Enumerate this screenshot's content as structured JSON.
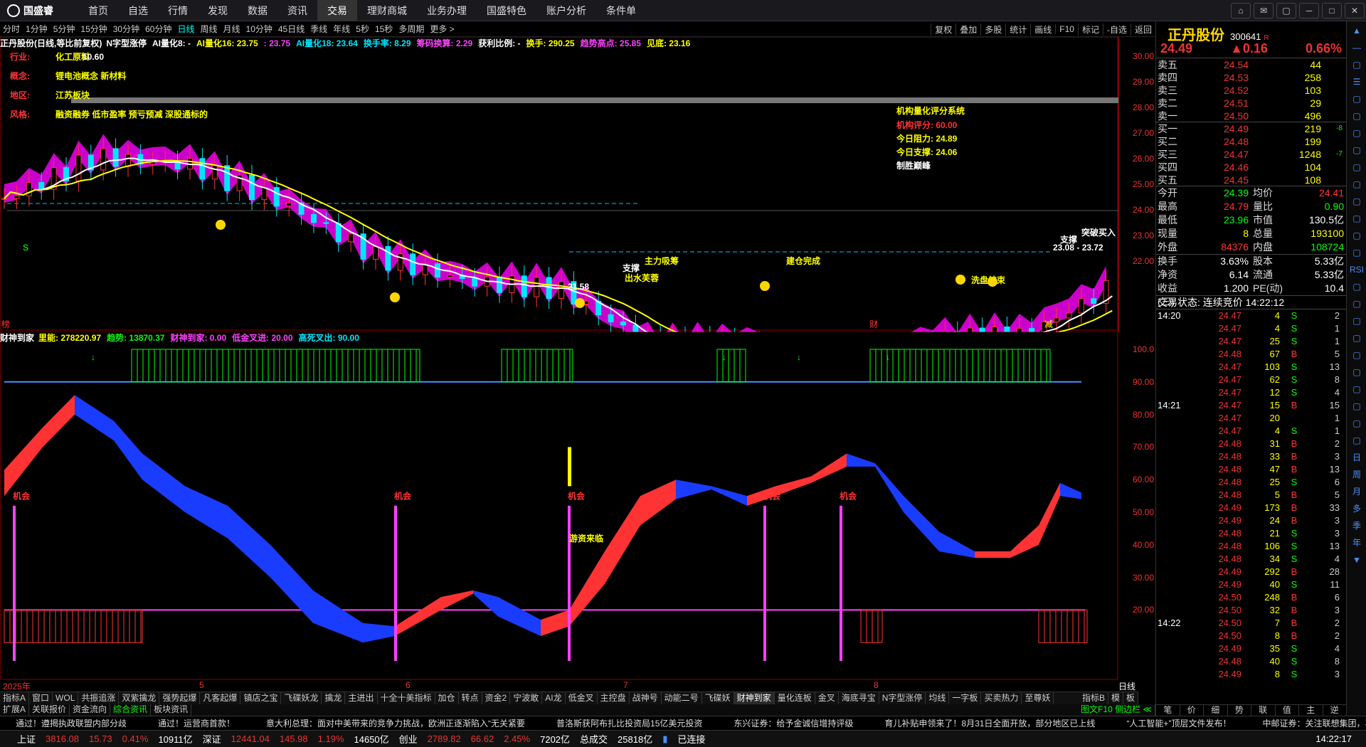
{
  "app": {
    "logo_text": "国盛睿"
  },
  "menu": [
    "首页",
    "自选",
    "行情",
    "发现",
    "数据",
    "资讯",
    "交易",
    "理财商城",
    "业务办理",
    "国盛特色",
    "账户分析",
    "条件单"
  ],
  "window_controls": [
    "⌂",
    "✉",
    "▢",
    "─",
    "□",
    "✕"
  ],
  "periods": [
    "分时",
    "1分钟",
    "5分钟",
    "15分钟",
    "30分钟",
    "60分钟",
    "日线",
    "周线",
    "月线",
    "10分钟",
    "45日线",
    "季线",
    "年线",
    "5秒",
    "15秒",
    "多周期",
    "更多 >"
  ],
  "active_period": "日线",
  "tools": [
    "复权",
    "叠加",
    "多股",
    "统计",
    "画线",
    "F10",
    "标记",
    "-自选",
    "返回"
  ],
  "indicator1": {
    "title": "正丹股份(日线,等比前复权)",
    "items": [
      {
        "t": "N字型涨停",
        "c": "wh"
      },
      {
        "t": "AI量化8: -",
        "c": "wh"
      },
      {
        "t": "AI量化16: 23.75",
        "c": "yl"
      },
      {
        "t": ": 23.75",
        "c": "mg"
      },
      {
        "t": "AI量化18: 23.64",
        "c": "cy"
      },
      {
        "t": "换手率: 8.29",
        "c": "cy"
      },
      {
        "t": "筹码换算: 2.29",
        "c": "mg"
      },
      {
        "t": "获利比例: -",
        "c": "wh"
      },
      {
        "t": "换手: 290.25",
        "c": "yl"
      },
      {
        "t": "趋势高点: 25.85",
        "c": "mg"
      },
      {
        "t": "见底: 23.16",
        "c": "yl"
      }
    ]
  },
  "info_panel": [
    {
      "label": "行业:",
      "value": "化工原料"
    },
    {
      "label": "概念:",
      "value": "锂电池概念 新材料"
    },
    {
      "label": "地区:",
      "value": "江苏板块"
    },
    {
      "label": "风格:",
      "value": "融资融券 低市盈率 预亏预减 深股通标的"
    }
  ],
  "score_box": {
    "title": "机构量化评分系统",
    "rows": [
      {
        "t": "机构评分: 60.00",
        "c": "up"
      },
      {
        "t": "今日阻力: 24.89",
        "c": "yl"
      },
      {
        "t": "今日支撑: 24.06",
        "c": "yl"
      },
      {
        "t": "制胜巅峰",
        "c": "wh"
      }
    ]
  },
  "annotations": [
    {
      "t": "10.60",
      "c": "wh"
    },
    {
      "t": "←21.58",
      "c": "wh"
    },
    {
      "t": "支撑",
      "c": "wh"
    },
    {
      "t": "出水芙蓉",
      "c": "yl"
    },
    {
      "t": "主力吸筹",
      "c": "yl"
    },
    {
      "t": "建仓完成",
      "c": "yl"
    },
    {
      "t": "洗盘结束",
      "c": "yl"
    },
    {
      "t": "支撑",
      "c": "wh"
    },
    {
      "t": "突破买入",
      "c": "wh"
    },
    {
      "t": "23.08 - 23.72",
      "c": "wh"
    }
  ],
  "main_markers": [
    "榜",
    "S",
    "S",
    "财",
    "减"
  ],
  "main_y_axis": [
    "30.00",
    "29.00",
    "28.00",
    "27.00",
    "26.00",
    "25.00",
    "24.00",
    "23.00",
    "22.00"
  ],
  "indicator2": {
    "title": "财神到家",
    "items": [
      {
        "t": "里能: 278220.97",
        "c": "yl"
      },
      {
        "t": "趋势: 13870.37",
        "c": "dn"
      },
      {
        "t": "财神到家: 0.00",
        "c": "mg"
      },
      {
        "t": "低金叉进: 20.00",
        "c": "mg"
      },
      {
        "t": "高死叉出: 90.00",
        "c": "cy"
      }
    ]
  },
  "sub_labels": [
    "机会",
    "机会",
    "机会",
    "机会",
    "机会"
  ],
  "sub_special_label": "游资来临",
  "sub_y_axis": [
    "100.0",
    "90.00",
    "80.00",
    "70.00",
    "60.00",
    "50.00",
    "40.00",
    "30.00",
    "20.00"
  ],
  "dates": [
    "2025年",
    "5",
    "6",
    "7",
    "8"
  ],
  "date_axis_label": "日线",
  "tabs1": [
    "指标A",
    "窗口",
    "WOL",
    "共振追涨",
    "双紫擒龙",
    "强势起爆",
    "凡客起爆",
    "镇店之宝",
    "飞碟妖龙",
    "擒龙",
    "主进出",
    "十全十美指标",
    "加仓",
    "转点",
    "资金2",
    "宁波敢",
    "AI龙",
    "低金叉",
    "主控盘",
    "战神号",
    "动能二号",
    "飞碟妖",
    "财神到家",
    "量化连板",
    "金叉",
    "海底寻宝",
    "N字型涨停",
    "均线",
    "一字板",
    "买卖热力",
    "至尊妖"
  ],
  "tabs1_active": "财神到家",
  "tabs1_right": [
    "指标B",
    "模",
    "板"
  ],
  "tabs2": [
    "扩展A",
    "关联报价",
    "资金流向",
    "综合资讯",
    "板块资讯"
  ],
  "tabs2_active": "综合资讯",
  "tabs2_right": "图文F10 侧边栏 ≪",
  "news": [
    "通过！遵揭执政联盟内部分歧",
    "通过！运营商首款！",
    "意大利总理：面对中美带来的竞争力挑战，欧洲正逐渐陷入“无关紧要",
    "普洛斯获阿布扎比投资局15亿美元投资",
    "东兴证券：给予金诚信增持评级",
    "育儿补贴申领来了！8月31日全面开放，部分地区已上线",
    "“人工智能+”顶层文件发布！",
    "中邮证券：关注联想集团，再次..."
  ],
  "status": {
    "sh": {
      "label": "上证",
      "value": "3816.08",
      "chg": "15.73",
      "pct": "0.41%",
      "amt": "10911亿"
    },
    "sz": {
      "label": "深证",
      "value": "12441.04",
      "chg": "145.98",
      "pct": "1.19%",
      "amt": "14650亿"
    },
    "cy": {
      "label": "创业",
      "value": "2789.82",
      "chg": "66.62",
      "pct": "2.45%",
      "amt": "7202亿"
    },
    "total": {
      "label": "总成交",
      "value": "25818亿"
    },
    "connected": "已连接",
    "time": "14:22:17"
  },
  "quote": {
    "name": "正丹股份",
    "code": "300641",
    "badge": "R",
    "price": "24.49",
    "change": "▲0.16",
    "pct": "0.66%",
    "asks": [
      {
        "label": "卖五",
        "price": "24.54",
        "vol": "44",
        "chg": ""
      },
      {
        "label": "卖四",
        "price": "24.53",
        "vol": "258",
        "chg": ""
      },
      {
        "label": "卖三",
        "price": "24.52",
        "vol": "103",
        "chg": ""
      },
      {
        "label": "卖二",
        "price": "24.51",
        "vol": "29",
        "chg": ""
      },
      {
        "label": "卖一",
        "price": "24.50",
        "vol": "496",
        "chg": ""
      }
    ],
    "bids": [
      {
        "label": "买一",
        "price": "24.49",
        "vol": "219",
        "chg": "-8"
      },
      {
        "label": "买二",
        "price": "24.48",
        "vol": "199",
        "chg": ""
      },
      {
        "label": "买三",
        "price": "24.47",
        "vol": "1248",
        "chg": "-7"
      },
      {
        "label": "买四",
        "price": "24.46",
        "vol": "104",
        "chg": ""
      },
      {
        "label": "买五",
        "price": "24.45",
        "vol": "108",
        "chg": ""
      }
    ],
    "stats": [
      {
        "k1": "今开",
        "v1": "24.39",
        "c1": "dn",
        "k2": "均价",
        "v2": "24.41",
        "c2": "up"
      },
      {
        "k1": "最高",
        "v1": "24.79",
        "c1": "up",
        "k2": "量比",
        "v2": "0.90",
        "c2": "dn"
      },
      {
        "k1": "最低",
        "v1": "23.96",
        "c1": "dn",
        "k2": "市值",
        "v2": "130.5亿",
        "c2": "wh"
      },
      {
        "k1": "现量",
        "v1": "8",
        "c1": "yl",
        "k2": "总量",
        "v2": "193100",
        "c2": "yl"
      },
      {
        "k1": "外盘",
        "v1": "84376",
        "c1": "up",
        "k2": "内盘",
        "v2": "108724",
        "c2": "dn"
      }
    ],
    "stats2": [
      {
        "k1": "换手",
        "v1": "3.63%",
        "k2": "股本",
        "v2": "5.33亿"
      },
      {
        "k1": "净资",
        "v1": "6.14",
        "k2": "流通",
        "v2": "5.33亿"
      },
      {
        "k1": "收益(三)",
        "v1": "1.200",
        "k2": "PE(动)",
        "v2": "10.4"
      }
    ],
    "auction": "交易状态: 连续竞价 14:22:12"
  },
  "ticks": [
    {
      "time": "14:20",
      "price": "24.47",
      "vol": "4",
      "bs": "S",
      "n": "2"
    },
    {
      "time": "",
      "price": "24.47",
      "vol": "4",
      "bs": "S",
      "n": "1"
    },
    {
      "time": "",
      "price": "24.47",
      "vol": "25",
      "bs": "S",
      "n": "1"
    },
    {
      "time": "",
      "price": "24.48",
      "vol": "67",
      "bs": "B",
      "n": "5"
    },
    {
      "time": "",
      "price": "24.47",
      "vol": "103",
      "bs": "S",
      "n": "13"
    },
    {
      "time": "",
      "price": "24.47",
      "vol": "62",
      "bs": "S",
      "n": "8"
    },
    {
      "time": "",
      "price": "24.47",
      "vol": "12",
      "bs": "S",
      "n": "4"
    },
    {
      "time": "14:21",
      "price": "24.47",
      "vol": "15",
      "bs": "B",
      "n": "15"
    },
    {
      "time": "",
      "price": "24.47",
      "vol": "20",
      "bs": "",
      "n": "1"
    },
    {
      "time": "",
      "price": "24.47",
      "vol": "4",
      "bs": "S",
      "n": "1"
    },
    {
      "time": "",
      "price": "24.48",
      "vol": "31",
      "bs": "B",
      "n": "2"
    },
    {
      "time": "",
      "price": "24.48",
      "vol": "33",
      "bs": "B",
      "n": "3"
    },
    {
      "time": "",
      "price": "24.48",
      "vol": "47",
      "bs": "B",
      "n": "13"
    },
    {
      "time": "",
      "price": "24.48",
      "vol": "25",
      "bs": "S",
      "n": "6"
    },
    {
      "time": "",
      "price": "24.48",
      "vol": "5",
      "bs": "B",
      "n": "5"
    },
    {
      "time": "",
      "price": "24.49",
      "vol": "173",
      "bs": "B",
      "n": "33"
    },
    {
      "time": "",
      "price": "24.49",
      "vol": "24",
      "bs": "B",
      "n": "3"
    },
    {
      "time": "",
      "price": "24.48",
      "vol": "21",
      "bs": "S",
      "n": "3"
    },
    {
      "time": "",
      "price": "24.48",
      "vol": "106",
      "bs": "S",
      "n": "13"
    },
    {
      "time": "",
      "price": "24.48",
      "vol": "34",
      "bs": "S",
      "n": "4"
    },
    {
      "time": "",
      "price": "24.49",
      "vol": "292",
      "bs": "B",
      "n": "28"
    },
    {
      "time": "",
      "price": "24.49",
      "vol": "40",
      "bs": "S",
      "n": "11"
    },
    {
      "time": "",
      "price": "24.50",
      "vol": "248",
      "bs": "B",
      "n": "6"
    },
    {
      "time": "",
      "price": "24.50",
      "vol": "32",
      "bs": "B",
      "n": "3"
    },
    {
      "time": "14:22",
      "price": "24.50",
      "vol": "7",
      "bs": "B",
      "n": "2"
    },
    {
      "time": "",
      "price": "24.50",
      "vol": "8",
      "bs": "B",
      "n": "2"
    },
    {
      "time": "",
      "price": "24.49",
      "vol": "35",
      "bs": "S",
      "n": "4"
    },
    {
      "time": "",
      "price": "24.48",
      "vol": "40",
      "bs": "S",
      "n": "8"
    },
    {
      "time": "",
      "price": "24.49",
      "vol": "8",
      "bs": "S",
      "n": "3"
    }
  ],
  "rp_tabs": [
    "笔",
    "价",
    "细",
    "势",
    "联",
    "值",
    "主",
    "逆"
  ],
  "side_icons": [
    "▲",
    "—",
    "▢",
    "☰",
    "▢",
    "▢",
    "▢",
    "▢",
    "▢",
    "▢",
    "▢",
    "▢",
    "▢",
    "▢",
    "RSI",
    "▢",
    "▢",
    "▢",
    "▢",
    "▢",
    "▢",
    "▢",
    "▢",
    "▢",
    "▢",
    "日",
    "周",
    "月",
    "多",
    "季",
    "年",
    "▼"
  ]
}
